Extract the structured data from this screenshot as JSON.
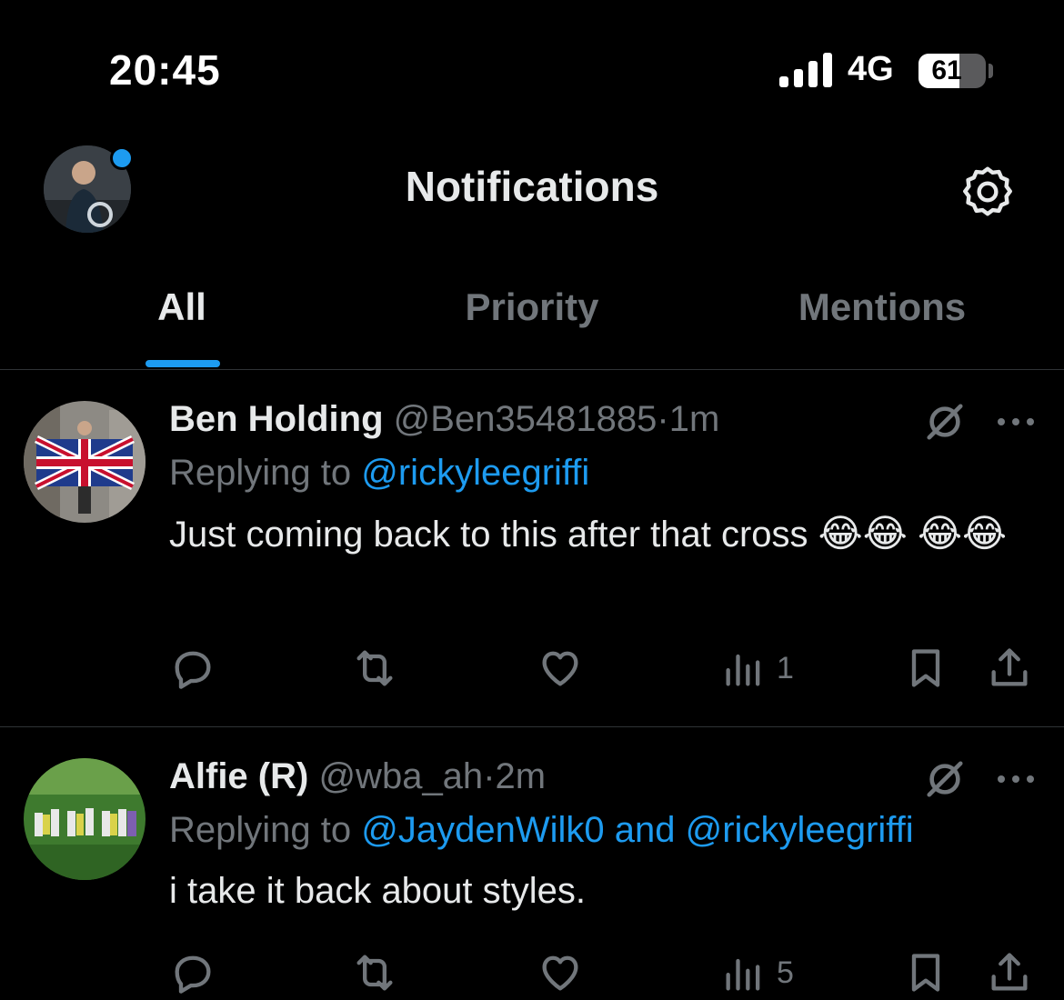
{
  "status_bar": {
    "time": "20:45",
    "network": "4G",
    "battery": "61",
    "battery_level_percent": 61,
    "icons": [
      "signal-icon",
      "battery-icon"
    ]
  },
  "header": {
    "title": "Notifications",
    "icons": [
      "profile-avatar",
      "gear-icon"
    ]
  },
  "tabs": [
    {
      "label": "All",
      "active": true
    },
    {
      "label": "Priority",
      "active": false
    },
    {
      "label": "Mentions",
      "active": false
    }
  ],
  "notifications": [
    {
      "name": "Ben Holding",
      "handle": "@Ben35481885",
      "separator": "·",
      "time_ago": "1m",
      "reply_prefix": "Replying to",
      "reply_to": "@rickyleegriffi",
      "text": "Just coming back to this after that cross",
      "emojis": [
        "😂",
        "😂",
        "😂",
        "😂"
      ],
      "views": "1"
    },
    {
      "name": "Alfie (R)",
      "handle": "@wba_ah",
      "separator": "·",
      "time_ago": "2m",
      "reply_prefix": "Replying to",
      "reply_to": "@JaydenWilk0",
      "reply_conjunction": "and",
      "reply_to_2": "@rickyleegriffi",
      "text": "i take it back about styles.",
      "views": "5"
    }
  ],
  "action_icons": [
    "reply-icon",
    "retweet-icon",
    "like-icon",
    "views-icon",
    "bookmark-icon",
    "share-icon"
  ],
  "colors": {
    "background": "#000000",
    "text_primary": "#e7e9ea",
    "text_secondary": "#71767b",
    "accent": "#1d9bf0",
    "divider": "#2f3336"
  }
}
